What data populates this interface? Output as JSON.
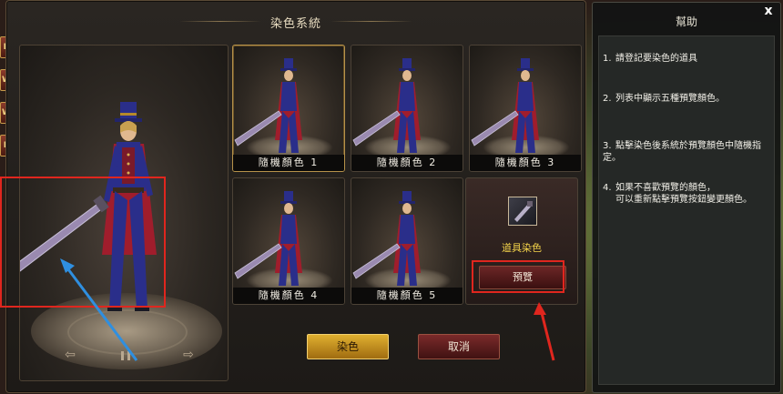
{
  "window": {
    "title": "染色系統"
  },
  "hud": {
    "icons": [
      "B",
      "W",
      "W",
      "P"
    ]
  },
  "swatches": [
    {
      "label": "隨機顏色 1",
      "selected": true
    },
    {
      "label": "隨機顏色 2",
      "selected": false
    },
    {
      "label": "隨機顏色 3",
      "selected": false
    },
    {
      "label": "隨機顏色 4",
      "selected": false
    },
    {
      "label": "隨機顏色 5",
      "selected": false
    }
  ],
  "item_panel": {
    "label": "道具染色",
    "preview_button": "預覽"
  },
  "buttons": {
    "dye": "染色",
    "cancel": "取消"
  },
  "help": {
    "title": "幫助",
    "close": "x",
    "items": [
      {
        "num": "1.",
        "text": "請登記要染色的道具"
      },
      {
        "num": "2.",
        "text": "列表中顯示五種預覽顏色。"
      },
      {
        "num": "3.",
        "text": "點擊染色後系統於預覽顏色中隨機指定。"
      },
      {
        "num": "4.",
        "text": "如果不喜歡預覽的顏色，",
        "sub": "可以重新點擊預覽按鈕變更顏色。"
      }
    ]
  },
  "colors": {
    "annotation_red": "#e0261e",
    "annotation_blue": "#2f8fe0",
    "item_label": "#f3d34a",
    "dye_button": "#e0b030"
  }
}
